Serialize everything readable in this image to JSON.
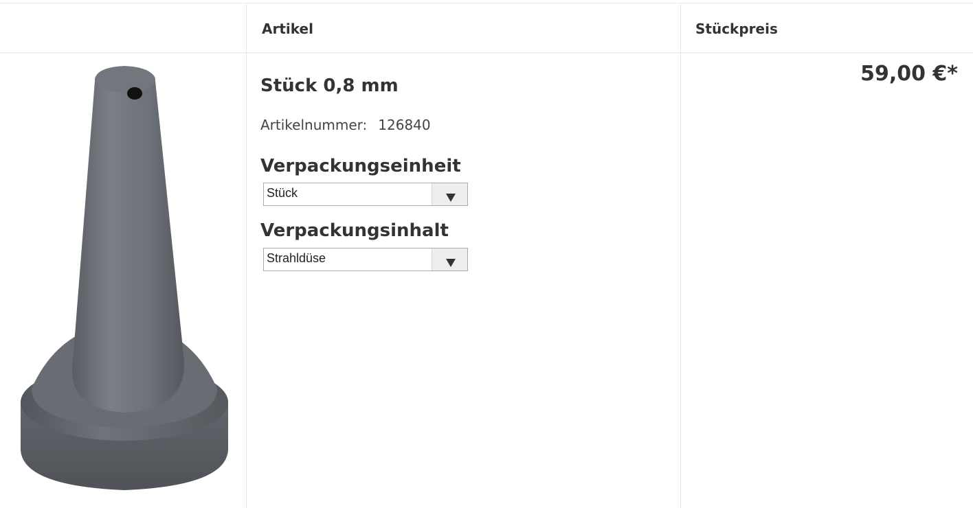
{
  "table": {
    "headers": {
      "image": "",
      "article": "Artikel",
      "unit_price": "Stückpreis"
    }
  },
  "product": {
    "title": "Stück 0,8 mm",
    "article_number_label": "Artikelnummer:",
    "article_number": "126840",
    "packaging_unit": {
      "label": "Verpackungseinheit",
      "selected": "Stück"
    },
    "packaging_content": {
      "label": "Verpackungsinhalt",
      "selected": "Strahldüse"
    },
    "price": "59,00 €*",
    "image_icon": "blast-nozzle-product-image"
  },
  "colors": {
    "text": "#333333",
    "border": "#e6e6e6",
    "select_arrow_bg": "#eeeeee",
    "nozzle": "#6f737a"
  }
}
